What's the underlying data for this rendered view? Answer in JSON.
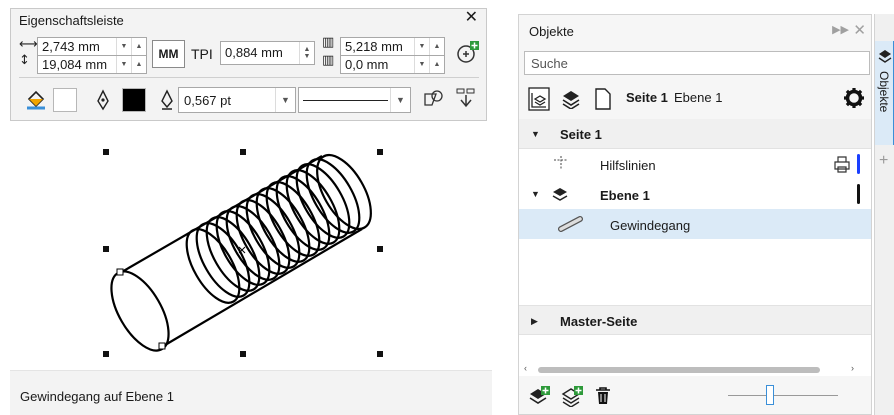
{
  "property_bar": {
    "title": "Eigenschaftsleiste",
    "close_icon": "✕",
    "width": "2,743 mm",
    "height": "19,084 mm",
    "unit_toggle": "MM",
    "tpi_label": "TPI",
    "tpi_value": "0,884 mm",
    "right_top": "5,218 mm",
    "right_bottom": "0,0 mm",
    "outline_width": "0,567 pt"
  },
  "status": {
    "text": "Gewindegang auf Ebene 1"
  },
  "objects_docker": {
    "title": "Objekte",
    "search_placeholder": "Suche",
    "toolbar_page": "Seite 1",
    "toolbar_layer": "Ebene 1",
    "tree": {
      "page_row": "Seite 1",
      "guides_row": "Hilfslinien",
      "layer_row": "Ebene 1",
      "object_row": "Gewindegang",
      "master_row": "Master-Seite"
    },
    "side_tab_label": "Objekte"
  },
  "colors": {
    "accent": "#3a8fd8",
    "selected_row": "#dbeaf7",
    "guides_bar": "#1a3fff",
    "layer_bar": "#111111"
  },
  "icons": [
    "fill-bucket-icon",
    "pen-nib-icon",
    "outline-pen-icon",
    "add-thread-icon",
    "layers-icon",
    "page-icon",
    "gear-icon",
    "trash-icon",
    "new-layer-icon",
    "new-master-layer-icon",
    "print-icon"
  ]
}
